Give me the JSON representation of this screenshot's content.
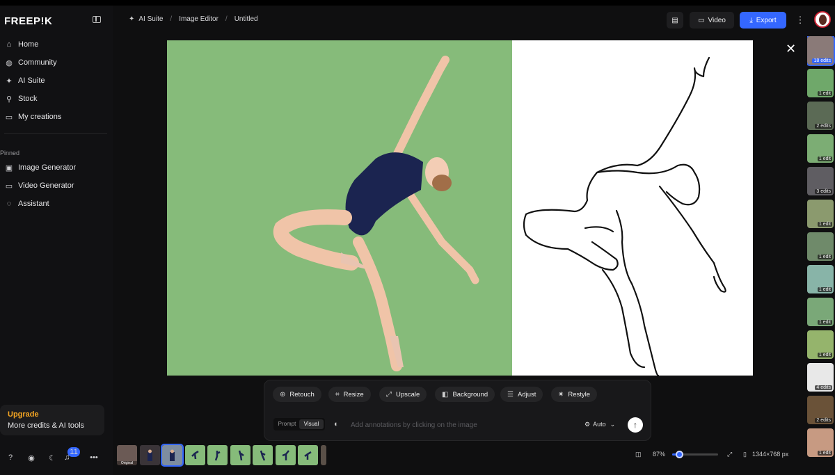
{
  "app": {
    "logo": "FREEP!K"
  },
  "sidebar": {
    "nav": [
      {
        "label": "Home",
        "icon": "home-icon"
      },
      {
        "label": "Community",
        "icon": "globe-icon"
      },
      {
        "label": "AI Suite",
        "icon": "sparkle-icon"
      },
      {
        "label": "Stock",
        "icon": "search-icon"
      },
      {
        "label": "My creations",
        "icon": "folder-icon"
      }
    ],
    "pinned_title": "Pinned",
    "pinned": [
      {
        "label": "Image Generator",
        "icon": "image-icon"
      },
      {
        "label": "Video Generator",
        "icon": "video-icon"
      },
      {
        "label": "Assistant",
        "icon": "chat-icon"
      }
    ],
    "upgrade": {
      "title": "Upgrade",
      "subtitle": "More credits & AI tools"
    },
    "notification_count": "11"
  },
  "breadcrumb": [
    "AI Suite",
    "Image Editor",
    "Untitled"
  ],
  "header": {
    "video_label": "Video",
    "export_label": "Export"
  },
  "tools": [
    "Retouch",
    "Resize",
    "Upscale",
    "Background",
    "Adjust",
    "Restyle"
  ],
  "prompt": {
    "mode_prompt": "Prompt",
    "mode_visual": "Visual",
    "active_mode": "Visual",
    "placeholder": "Add annotations by clicking on the image",
    "model": "Auto"
  },
  "filmstrip": {
    "original_label": "Original"
  },
  "zoom": {
    "level": "87%",
    "level_value": 0.15,
    "dimensions": "1344×768 px"
  },
  "history": [
    {
      "label": "18 edits"
    },
    {
      "label": "1 edit"
    },
    {
      "label": "2 edits"
    },
    {
      "label": "1 edit"
    },
    {
      "label": "3 edits"
    },
    {
      "label": "1 edit"
    },
    {
      "label": "1 edit"
    },
    {
      "label": "1 edit"
    },
    {
      "label": "1 edit"
    },
    {
      "label": "1 edit"
    },
    {
      "label": "4 edits"
    },
    {
      "label": "2 edits"
    },
    {
      "label": "1 edit"
    }
  ],
  "colors": {
    "accent": "#3467ff",
    "upgrade": "#f5a623",
    "green_screen": "#86bb7a",
    "background": "#0f0f10"
  }
}
